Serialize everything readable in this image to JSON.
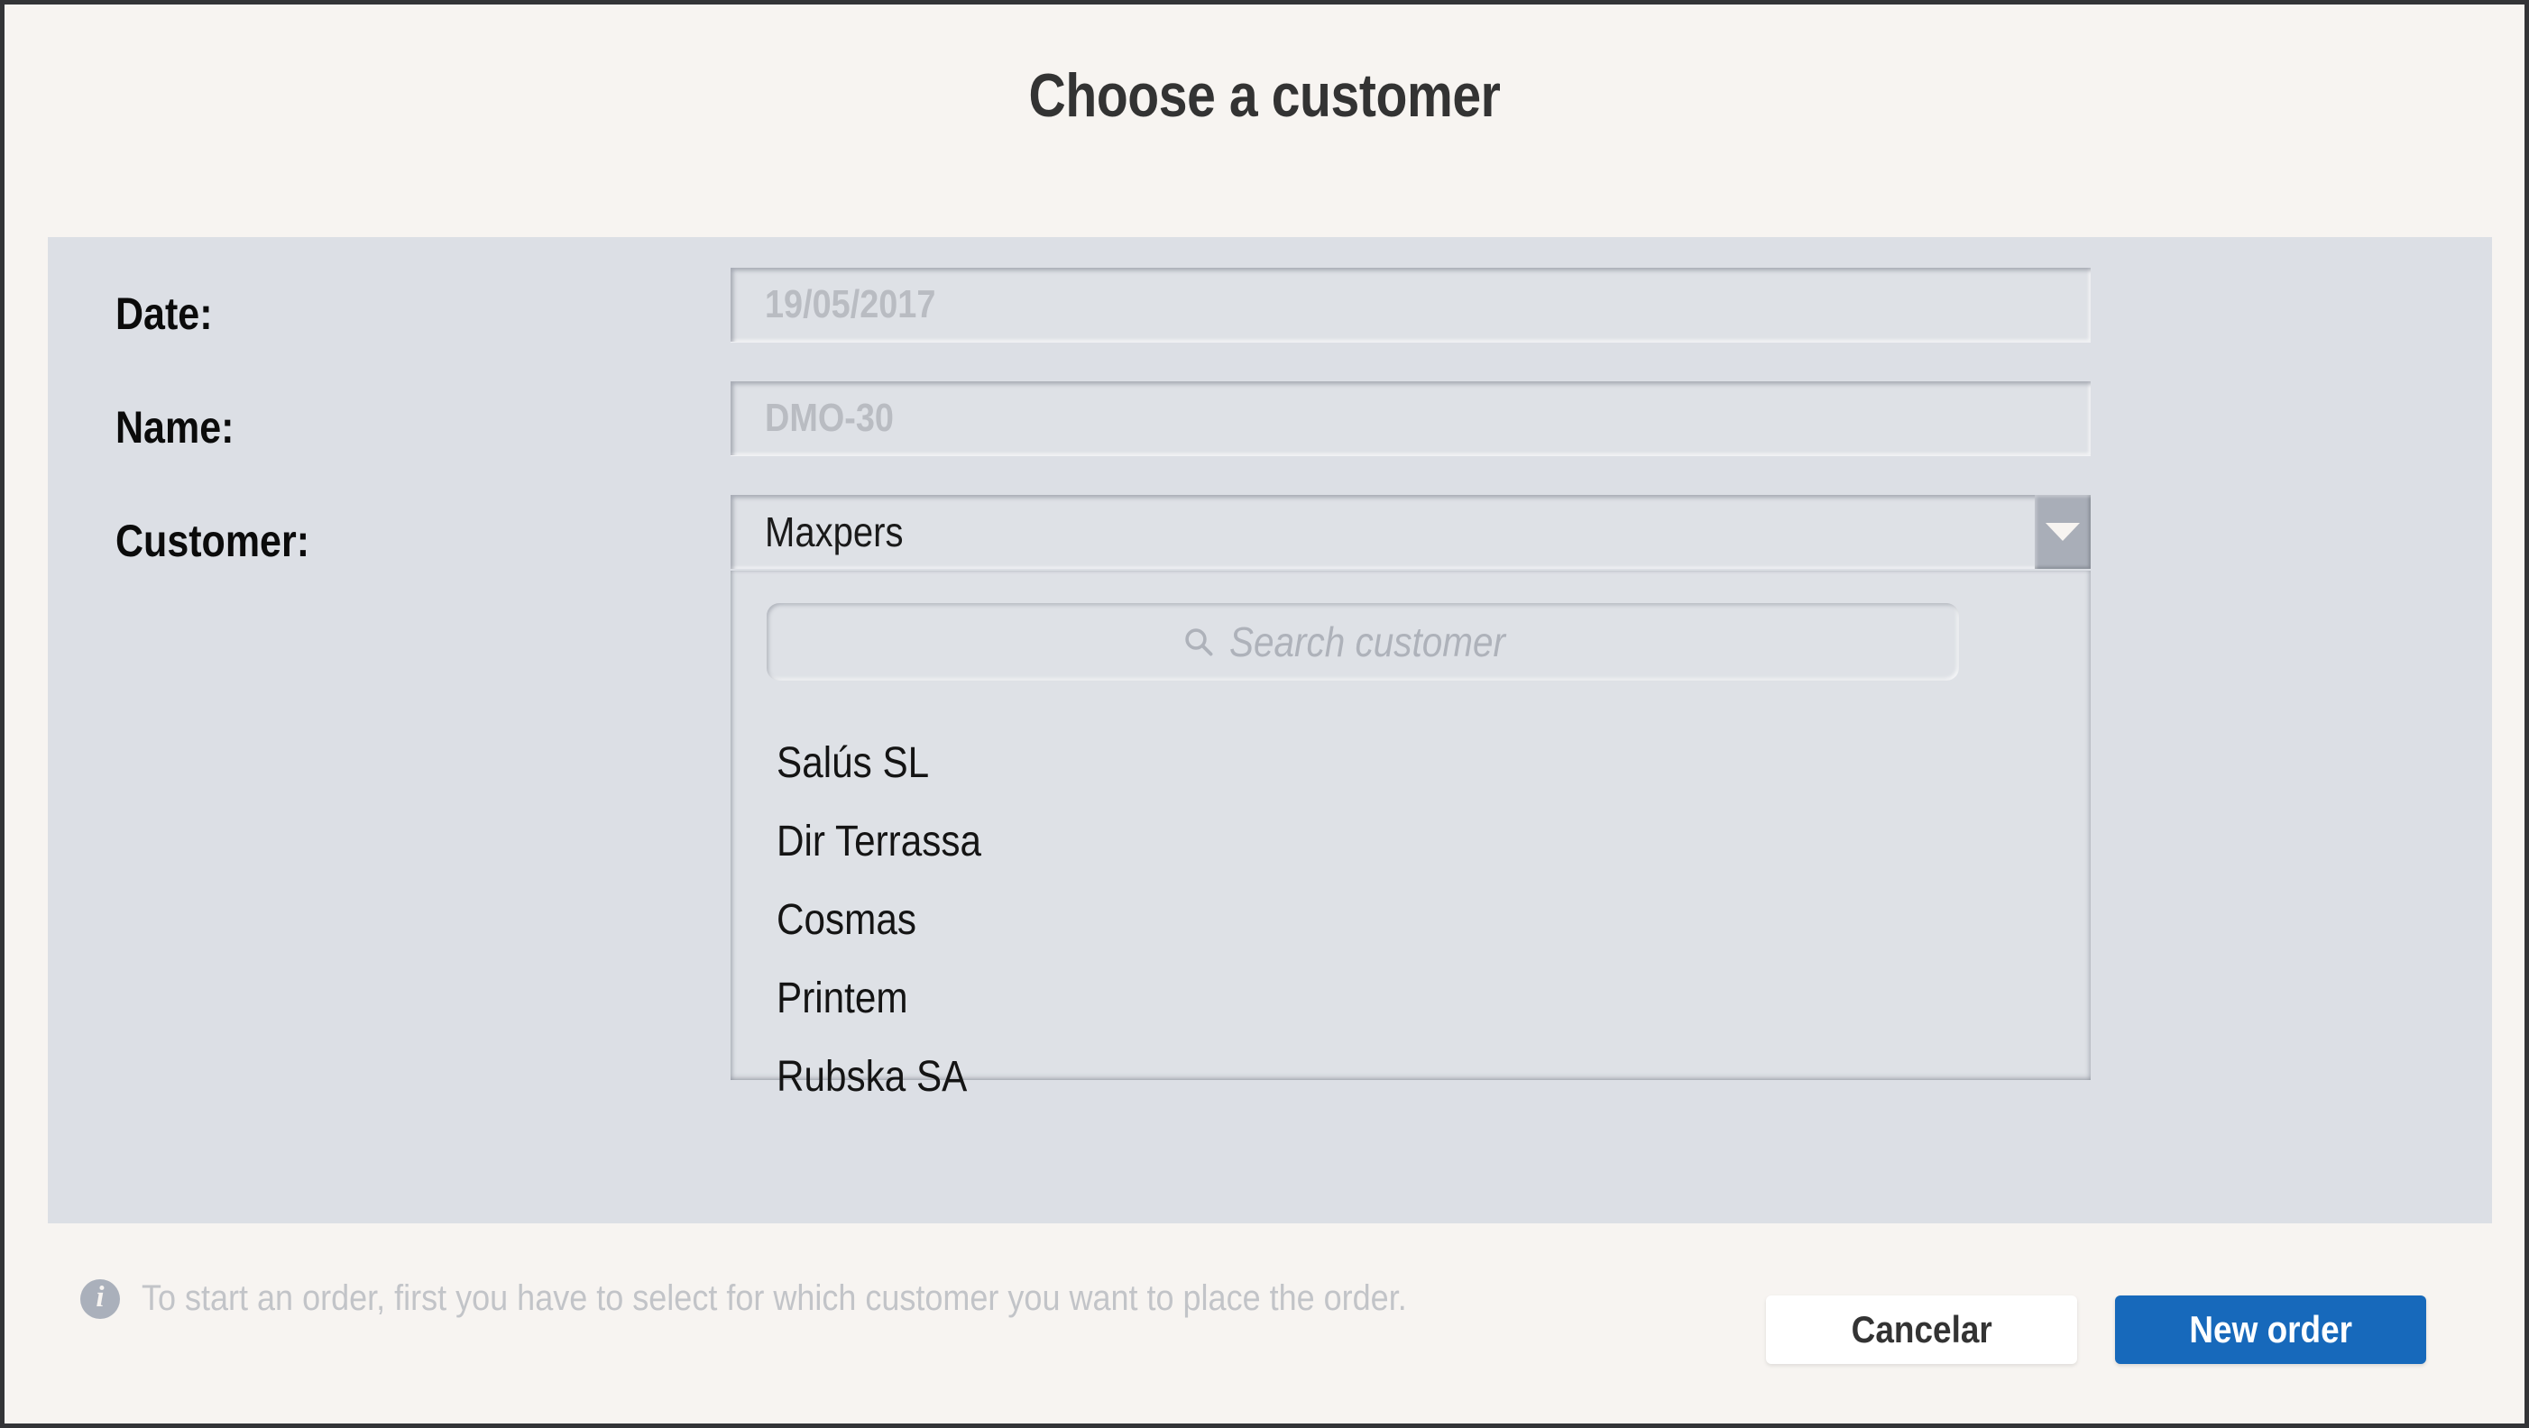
{
  "dialog": {
    "title": "Choose a customer"
  },
  "form": {
    "date": {
      "label": "Date:",
      "placeholder": "19/05/2017",
      "value": ""
    },
    "name": {
      "label": "Name:",
      "placeholder": "DMO-30",
      "value": ""
    },
    "customer": {
      "label": "Customer:",
      "selected": "Maxpers",
      "dropdown_open": true,
      "arrow_icon": "chevron-down-icon",
      "search": {
        "icon": "search-icon",
        "placeholder": "Search customer",
        "value": ""
      },
      "options": [
        "Salús SL",
        "Dir Terrassa",
        "Cosmas",
        "Printem",
        "Rubska SA"
      ]
    }
  },
  "footer": {
    "info_icon": "info-icon",
    "note": "To start an order, first you have to select for which customer you want to place the order.",
    "cancel_label": "Cancelar",
    "primary_label": "New order"
  },
  "colors": {
    "window_background": "#f7f4f1",
    "window_border": "#333437",
    "panel_background": "#dcdfe5",
    "field_background": "#dee1e6",
    "accent_blue": "#1769bb",
    "arrow_button": "#a9aeb8",
    "placeholder_text": "#b9bcc2",
    "muted_text": "#c2c4c8",
    "title_text": "#333333"
  }
}
